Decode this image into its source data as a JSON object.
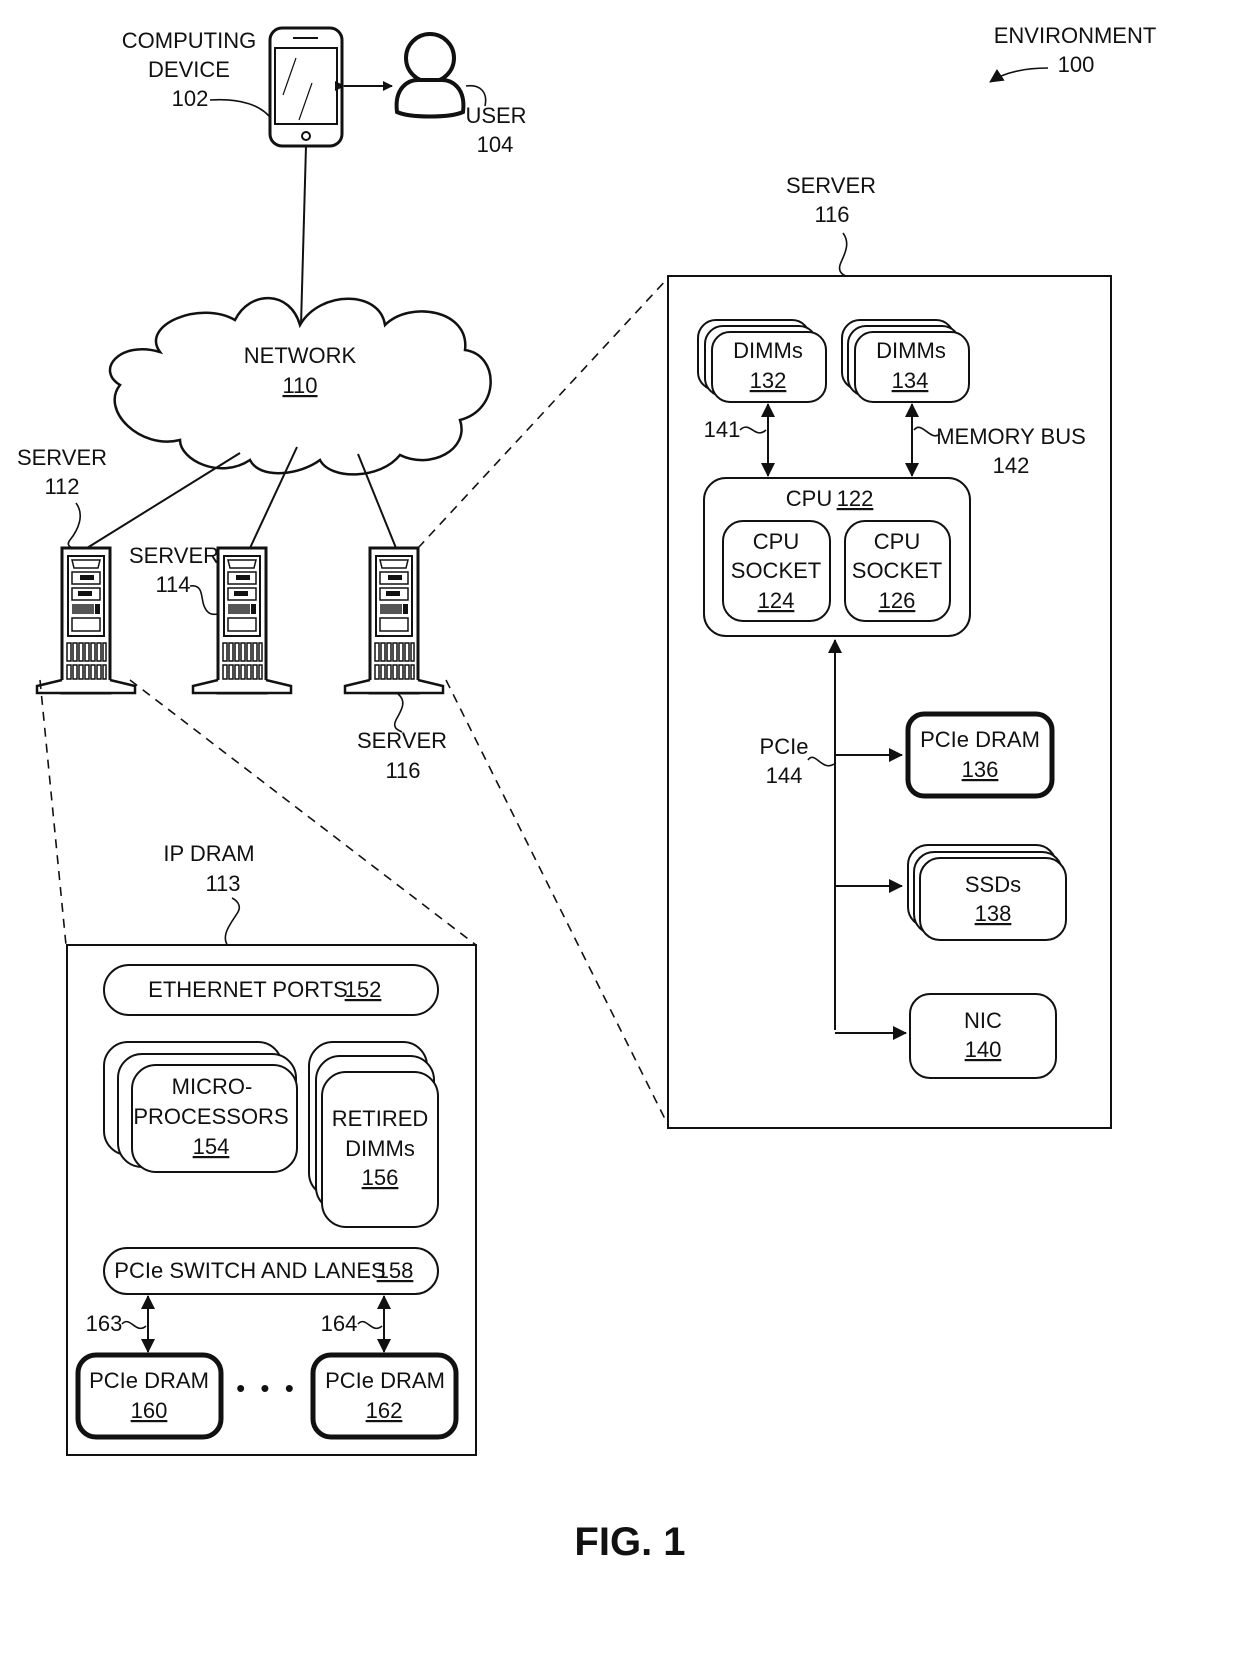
{
  "figure": {
    "caption": "FIG. 1",
    "environment": {
      "label": "ENVIRONMENT",
      "ref": "100"
    }
  },
  "top": {
    "computing_device": {
      "line1": "COMPUTING",
      "line2": "DEVICE",
      "ref": "102",
      "icon": "smartphone-icon"
    },
    "user": {
      "label": "USER",
      "ref": "104",
      "icon": "user-icon"
    },
    "network": {
      "label": "NETWORK",
      "ref": "110",
      "icon": "cloud-icon"
    },
    "servers": [
      {
        "label": "SERVER",
        "ref": "112",
        "icon": "server-tower-icon"
      },
      {
        "label": "SERVER",
        "ref": "114",
        "icon": "server-tower-icon"
      },
      {
        "label": "SERVER",
        "ref": "116",
        "icon": "server-tower-icon"
      }
    ]
  },
  "server_detail": {
    "title": "SERVER",
    "ref": "116",
    "dimms_a": {
      "label": "DIMMs",
      "ref": "132"
    },
    "dimms_b": {
      "label": "DIMMs",
      "ref": "134"
    },
    "link_141": "141",
    "memory_bus": {
      "label": "MEMORY BUS",
      "ref": "142"
    },
    "cpu": {
      "label": "CPU",
      "ref": "122"
    },
    "socket_a": {
      "line1": "CPU",
      "line2": "SOCKET",
      "ref": "124"
    },
    "socket_b": {
      "line1": "CPU",
      "line2": "SOCKET",
      "ref": "126"
    },
    "pcie": {
      "label": "PCIe",
      "ref": "144"
    },
    "pcie_dram": {
      "label": "PCIe DRAM",
      "ref": "136"
    },
    "ssds": {
      "label": "SSDs",
      "ref": "138"
    },
    "nic": {
      "label": "NIC",
      "ref": "140"
    }
  },
  "ip_dram_detail": {
    "title": "IP DRAM",
    "ref": "113",
    "ethernet": {
      "label": "ETHERNET PORTS",
      "ref": "152"
    },
    "microprocessors": {
      "line1": "MICRO-",
      "line2": "PROCESSORS",
      "ref": "154"
    },
    "retired_dimms": {
      "line1": "RETIRED",
      "line2": "DIMMs",
      "ref": "156"
    },
    "pcie_switch": {
      "label": "PCIe SWITCH AND LANES",
      "ref": "158"
    },
    "link_163": "163",
    "link_164": "164",
    "pcie_dram_a": {
      "label": "PCIe DRAM",
      "ref": "160"
    },
    "pcie_dram_b": {
      "label": "PCIe DRAM",
      "ref": "162"
    },
    "ellipsis": "• • •"
  }
}
